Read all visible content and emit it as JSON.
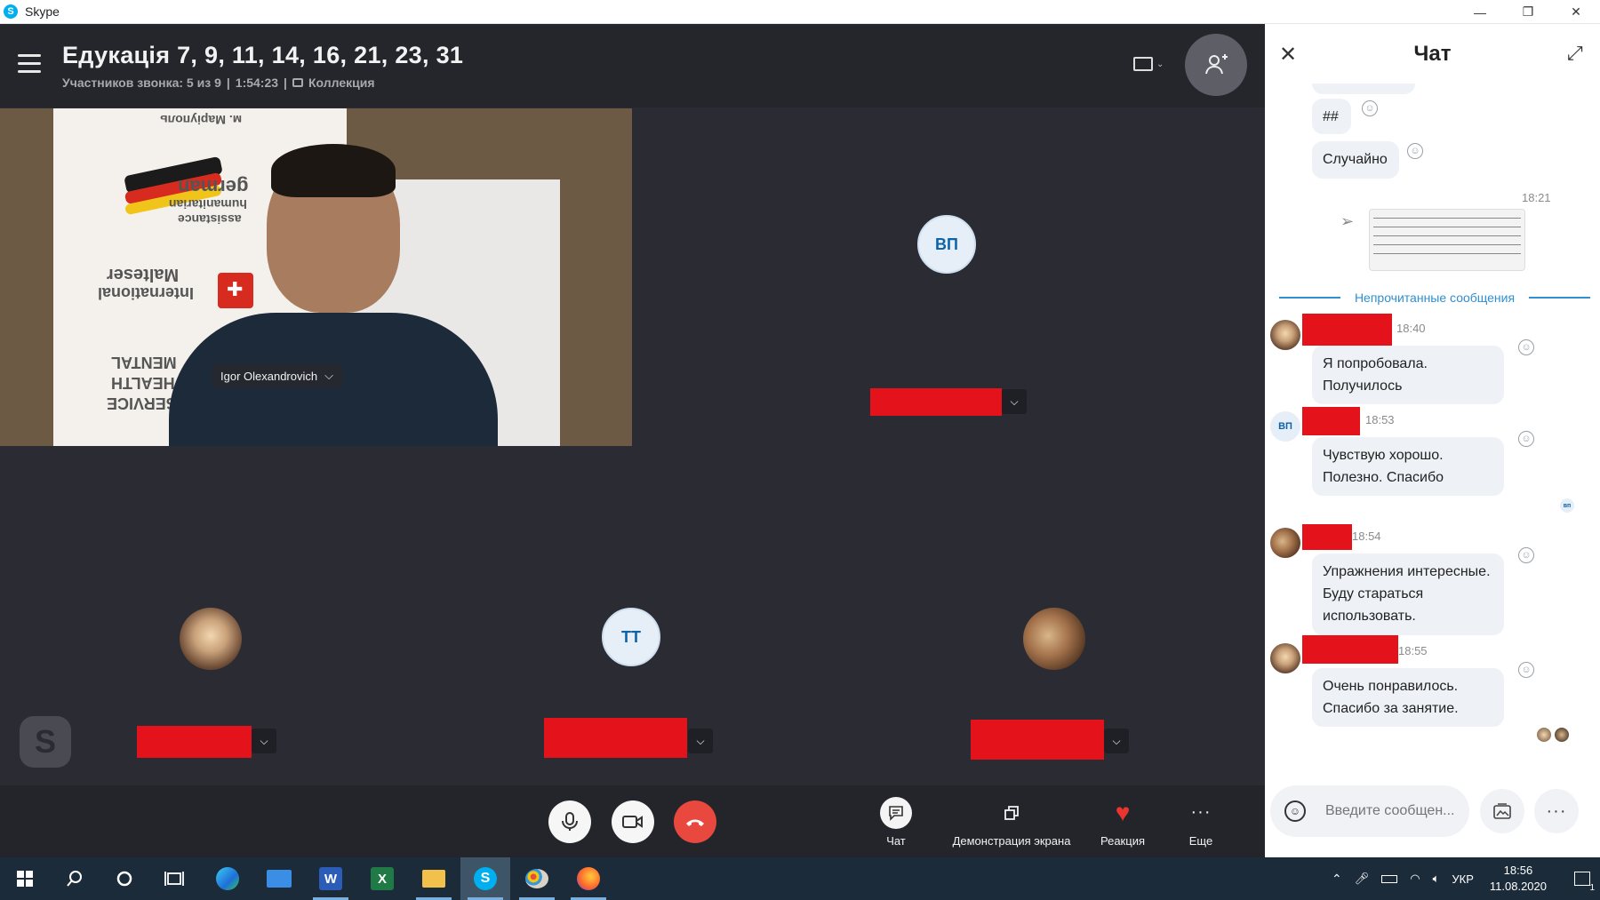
{
  "window": {
    "title": "Skype",
    "minimize": "—",
    "restore": "❐",
    "close": "✕"
  },
  "call": {
    "title": "Едукація 7, 9, 11, 14, 16, 21, 23, 31",
    "participants": "Участников звонка: 5 из 9",
    "duration": "1:54:23",
    "separator": "|",
    "collection": "Коллекция"
  },
  "tiles": {
    "main_video_name": "Igor Olexandrovich",
    "banner_city": "м. Маріуполь",
    "banner_line1": "german",
    "banner_line2": "humanitarian",
    "banner_line3": "assistance",
    "banner_malteser1": "Malteser",
    "banner_malteser2": "International",
    "banner_mental1": "MENTAL",
    "banner_mental2": "HEALTH",
    "banner_mental3": "SERVICE",
    "vp_initials": "ВП",
    "tt_initials": "ТТ"
  },
  "controls": {
    "chat": "Чат",
    "screen_share": "Демонстрация экрана",
    "reaction": "Реакция",
    "more": "Еще"
  },
  "chat": {
    "title": "Чат",
    "messages": [
      {
        "text": "##"
      },
      {
        "text": "Случайно"
      }
    ],
    "image_time": "18:21",
    "unread_label": "Непрочитанные сообщения",
    "incoming": [
      {
        "time": "18:40",
        "line1": "Я попробовала.",
        "line2": "Получилось",
        "line3": ""
      },
      {
        "time": "18:53",
        "initials": "ВП",
        "line1": "Чувствую хорошо.",
        "line2": "Полезно. Спасибо",
        "line3": ""
      },
      {
        "time": "18:54",
        "line1": "Упражнения интересные.",
        "line2": "Буду стараться",
        "line3": "использовать."
      },
      {
        "time": "18:55",
        "line1": "Очень понравилось.",
        "line2": "Спасибо за занятие.",
        "line3": ""
      }
    ],
    "seen_initials": "вп",
    "compose_placeholder": "Введите сообщен..."
  },
  "taskbar": {
    "language": "УКР",
    "time": "18:56",
    "date": "11.08.2020",
    "notifications": "1"
  },
  "colors": {
    "accent": "#2f8fcf",
    "end_call": "#e8483e",
    "redaction": "#e3121b",
    "skype_blue": "#00aff0"
  }
}
